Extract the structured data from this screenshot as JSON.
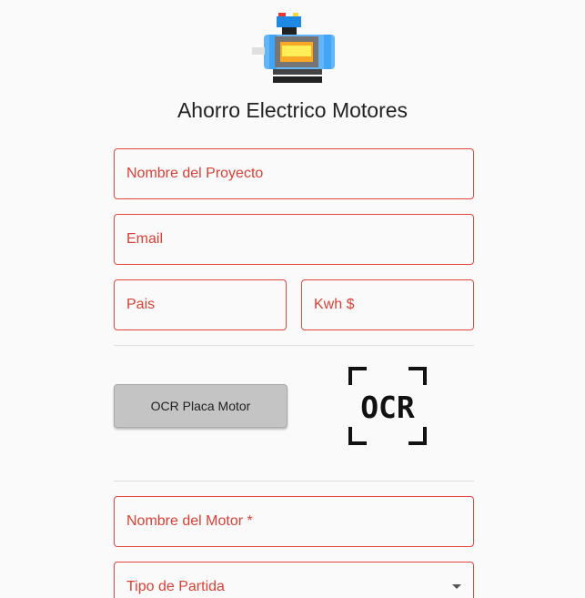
{
  "header": {
    "title": "Ahorro Electrico Motores",
    "logo_icon": "electric-motor-icon"
  },
  "form": {
    "project_name_label": "Nombre del Proyecto",
    "email_label": "Email",
    "country_label": "Pais",
    "kwh_label": "Kwh $",
    "ocr_button_label": "OCR Placa Motor",
    "ocr_icon_text": "OCR",
    "motor_name_label": "Nombre del Motor *",
    "start_type_label": "Tipo de Partida"
  },
  "colors": {
    "error_border": "#e0463a",
    "error_text": "#d94136",
    "button_bg": "#c4c4c4",
    "background": "#fafafa"
  }
}
